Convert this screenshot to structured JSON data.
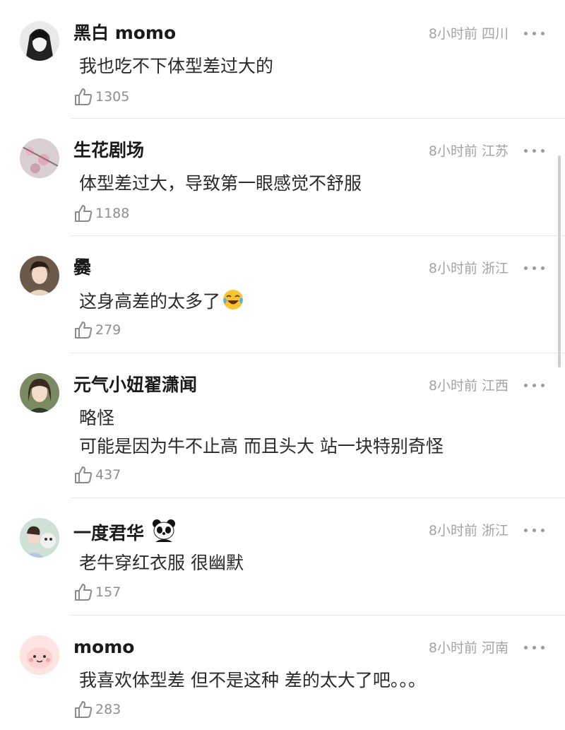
{
  "comments": [
    {
      "name": "黑白 momo",
      "meta": "8小时前 四川",
      "lines": [
        "我也吃不下体型差过大的"
      ],
      "likes": "1305"
    },
    {
      "name": "生花剧场",
      "meta": "8小时前 江苏",
      "lines": [
        "体型差过大，导致第一眼感觉不舒服"
      ],
      "likes": "1188"
    },
    {
      "name": "爨",
      "meta": "8小时前 浙江",
      "lines": [
        "这身高差的太多了"
      ],
      "likes": "279"
    },
    {
      "name": "元气小妞翟潇闻",
      "meta": "8小时前 江西",
      "lines": [
        "略怪",
        "可能是因为牛不止高 而且头大 站一块特别奇怪"
      ],
      "likes": "437"
    },
    {
      "name": "一度君华",
      "meta": "8小时前 浙江",
      "lines": [
        "老牛穿红衣服 很幽默"
      ],
      "likes": "157"
    },
    {
      "name": "momo",
      "meta": "8小时前 河南",
      "lines": [
        "我喜欢体型差 但不是这种 差的太大了吧。。。"
      ],
      "likes": "283"
    }
  ],
  "icons": {
    "like": "thumbs-up-icon",
    "more": "more-dots-icon",
    "emoji_laugh": "tears-of-joy-emoji",
    "emoji_panda": "panda-emoji"
  }
}
